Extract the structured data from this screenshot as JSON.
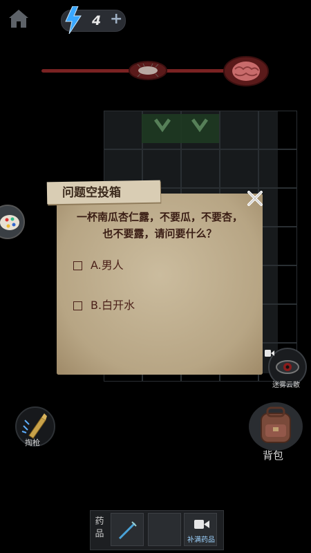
{
  "top": {
    "energy_value": "4",
    "plus": "+"
  },
  "dialog": {
    "title": "问题空投箱",
    "question_line1": "一杯南瓜杏仁露，不要瓜，不要杏，",
    "question_line2": "也不要露，请问要什么？",
    "options": [
      {
        "label": "A.男人"
      },
      {
        "label": "B.白开水"
      }
    ]
  },
  "side": {
    "fog_label": "迷雾云散",
    "bag_label": "背包",
    "gun_label": "掏枪"
  },
  "bottom": {
    "medicine_label": "药品",
    "refill_label": "补满药品"
  }
}
